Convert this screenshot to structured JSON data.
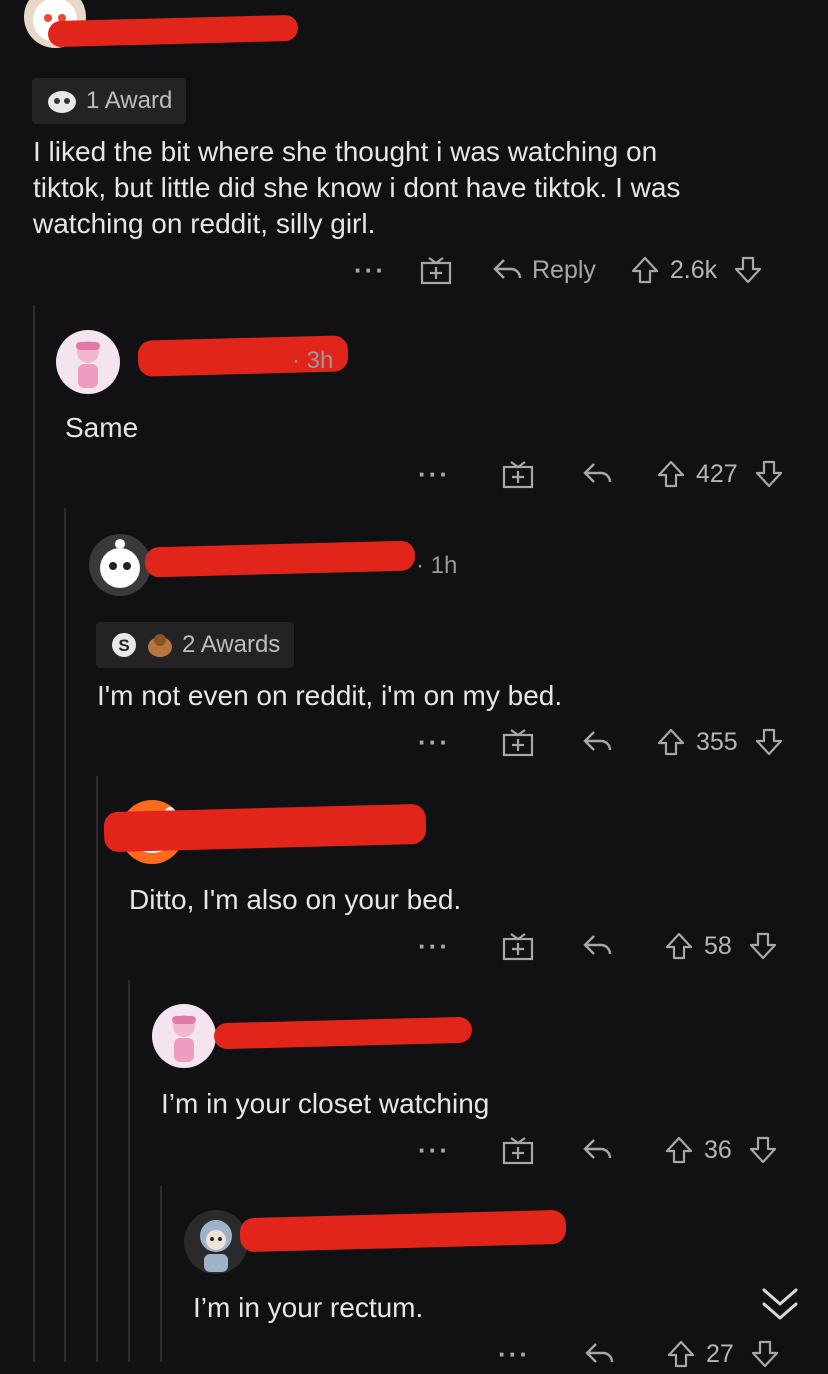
{
  "colors": {
    "background": "#111113",
    "text": "#e6e6e6",
    "muted": "#9a9a9a",
    "redaction": "#e1251b",
    "thread_line": "#2c2c2e"
  },
  "icons": [
    "snoo-avatar",
    "award-icon",
    "more-dots-icon",
    "give-award-icon",
    "reply-icon",
    "upvote-icon",
    "downvote-icon",
    "collapse-chevron-icon"
  ],
  "comments": [
    {
      "time": "",
      "awards": "1 Award",
      "body": [
        "I liked the bit where she thought i was watching on",
        "tiktok, but little did she know i dont have tiktok. I was",
        "watching on reddit, silly girl."
      ],
      "reply_label": "Reply",
      "score": "2.6k"
    },
    {
      "time": "· 3h",
      "awards": "",
      "body": [
        "Same"
      ],
      "reply_label": "",
      "score": "427"
    },
    {
      "time": "· 1h",
      "awards": "2 Awards",
      "body": [
        "I'm not even on reddit, i'm on my bed."
      ],
      "reply_label": "",
      "score": "355"
    },
    {
      "time": "",
      "awards": "",
      "body": [
        "Ditto, I'm also on your bed."
      ],
      "reply_label": "",
      "score": "58"
    },
    {
      "time": "",
      "awards": "",
      "body": [
        "I’m in your closet watching"
      ],
      "reply_label": "",
      "score": "36"
    },
    {
      "time": "",
      "awards": "",
      "body": [
        "I’m in your rectum."
      ],
      "reply_label": "",
      "score": "27"
    }
  ]
}
